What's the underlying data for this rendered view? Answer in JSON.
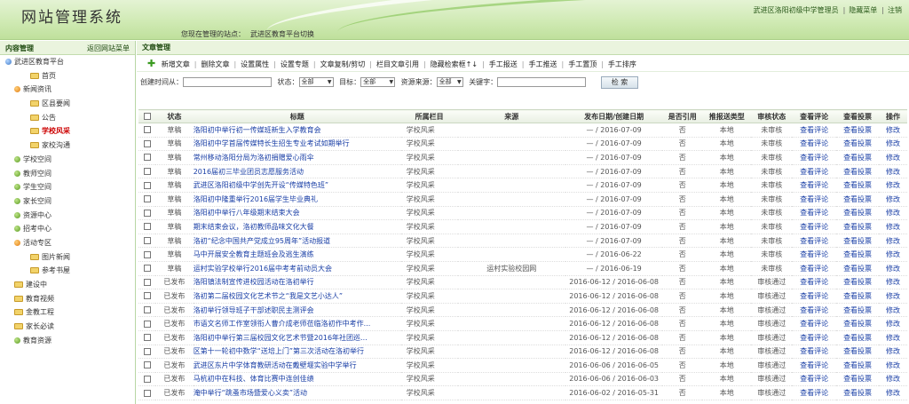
{
  "header": {
    "logo": "网站管理系统",
    "site_label": "您现在管理的站点：",
    "site_value": "武进区教育平台切换",
    "user": "武进区洛阳初级中学管理员",
    "hide_menu": "隐藏菜单",
    "logout": "注销"
  },
  "sidebar": {
    "title": "内容管理",
    "back": "返回网站菜单",
    "items": [
      {
        "label": "武进区教育平台",
        "level": 1,
        "icon": "globe-icon"
      },
      {
        "label": "首页",
        "level": 3,
        "icon": "folder-icon"
      },
      {
        "label": "新闻资讯",
        "level": 2,
        "icon": "orange-dot-icon"
      },
      {
        "label": "区县要闻",
        "level": 3,
        "icon": "folder-icon"
      },
      {
        "label": "公告",
        "level": 3,
        "icon": "folder-icon"
      },
      {
        "label": "学校风采",
        "level": 3,
        "icon": "folder-icon",
        "selected": true
      },
      {
        "label": "家校沟通",
        "level": 3,
        "icon": "folder-icon"
      },
      {
        "label": "学校空间",
        "level": 2,
        "icon": "green-dot-icon"
      },
      {
        "label": "教师空间",
        "level": 2,
        "icon": "green-dot-icon"
      },
      {
        "label": "学生空间",
        "level": 2,
        "icon": "green-dot-icon"
      },
      {
        "label": "家长空间",
        "level": 2,
        "icon": "green-dot-icon"
      },
      {
        "label": "资源中心",
        "level": 2,
        "icon": "green-dot-icon"
      },
      {
        "label": "招考中心",
        "level": 2,
        "icon": "green-dot-icon"
      },
      {
        "label": "活动专区",
        "level": 2,
        "icon": "orange-dot-icon"
      },
      {
        "label": "图片新闻",
        "level": 3,
        "icon": "folder-icon"
      },
      {
        "label": "参考书屋",
        "level": 3,
        "icon": "folder-icon"
      },
      {
        "label": "建设中",
        "level": 2,
        "icon": "folder-icon"
      },
      {
        "label": "教育视频",
        "level": 2,
        "icon": "folder-icon"
      },
      {
        "label": "金教工程",
        "level": 2,
        "icon": "folder-icon"
      },
      {
        "label": "家长必读",
        "level": 2,
        "icon": "folder-icon"
      },
      {
        "label": "教育资源",
        "level": 2,
        "icon": "green-dot-icon"
      }
    ]
  },
  "main": {
    "title": "文章管理",
    "toolbar": [
      "新增文章",
      "删除文章",
      "设置属性",
      "设置专题",
      "文章复制/剪切",
      "栏目文章引用",
      "隐藏检索框↑↓",
      "手工报送",
      "手工推送",
      "手工置顶",
      "手工排序"
    ],
    "filters": {
      "created_from": "创建时间从：",
      "status": "状态：",
      "status_value": "全部",
      "target": "目标：",
      "target_value": "全部",
      "source": "资源来源：",
      "source_value": "全部",
      "keyword": "关键字：",
      "search": "检 索"
    },
    "columns": [
      "状态",
      "标题",
      "所属栏目",
      "来源",
      "发布日期/创建日期",
      "是否引用",
      "推报送类型",
      "审核状态",
      "查看评论",
      "查看投票",
      "操作"
    ],
    "rows": [
      {
        "status": "草稿",
        "title": "洛阳初中举行初一传媒班新生入学教育会",
        "cat": "学校风采",
        "source": "",
        "date": "— / 2016-07-09",
        "ref": "否",
        "type": "本地",
        "audit": "未审核",
        "comment": "查看评论",
        "vote": "查看投票",
        "op": "修改"
      },
      {
        "status": "草稿",
        "title": "洛阳初中学首届传媒特长生招生专业考试如期举行",
        "cat": "学校风采",
        "source": "",
        "date": "— / 2016-07-09",
        "ref": "否",
        "type": "本地",
        "audit": "未审核",
        "comment": "查看评论",
        "vote": "查看投票",
        "op": "修改"
      },
      {
        "status": "草稿",
        "title": "常州移动洛阳分局为洛初捐赠爱心雨伞",
        "cat": "学校风采",
        "source": "",
        "date": "— / 2016-07-09",
        "ref": "否",
        "type": "本地",
        "audit": "未审核",
        "comment": "查看评论",
        "vote": "查看投票",
        "op": "修改"
      },
      {
        "status": "草稿",
        "title": "2016届初三毕业团员志愿服务活动",
        "cat": "学校风采",
        "source": "",
        "date": "— / 2016-07-09",
        "ref": "否",
        "type": "本地",
        "audit": "未审核",
        "comment": "查看评论",
        "vote": "查看投票",
        "op": "修改"
      },
      {
        "status": "草稿",
        "title": "武进区洛阳初级中学创先开设“传媒特色班”",
        "cat": "学校风采",
        "source": "",
        "date": "— / 2016-07-09",
        "ref": "否",
        "type": "本地",
        "audit": "未审核",
        "comment": "查看评论",
        "vote": "查看投票",
        "op": "修改"
      },
      {
        "status": "草稿",
        "title": "洛阳初中隆重举行2016届学生毕业典礼",
        "cat": "学校风采",
        "source": "",
        "date": "— / 2016-07-09",
        "ref": "否",
        "type": "本地",
        "audit": "未审核",
        "comment": "查看评论",
        "vote": "查看投票",
        "op": "修改"
      },
      {
        "status": "草稿",
        "title": "洛阳初中举行八年级期末结束大会",
        "cat": "学校风采",
        "source": "",
        "date": "— / 2016-07-09",
        "ref": "否",
        "type": "本地",
        "audit": "未审核",
        "comment": "查看评论",
        "vote": "查看投票",
        "op": "修改"
      },
      {
        "status": "草稿",
        "title": "期末结束会议，洛初教师品味文化大餐",
        "cat": "学校风采",
        "source": "",
        "date": "— / 2016-07-09",
        "ref": "否",
        "type": "本地",
        "audit": "未审核",
        "comment": "查看评论",
        "vote": "查看投票",
        "op": "修改"
      },
      {
        "status": "草稿",
        "title": "洛初“纪念中国共产党成立95周年”活动报道",
        "cat": "学校风采",
        "source": "",
        "date": "— / 2016-07-09",
        "ref": "否",
        "type": "本地",
        "audit": "未审核",
        "comment": "查看评论",
        "vote": "查看投票",
        "op": "修改"
      },
      {
        "status": "草稿",
        "title": "马中开展安全教育主题班会及逃生演练",
        "cat": "学校风采",
        "source": "",
        "date": "— / 2016-06-22",
        "ref": "否",
        "type": "本地",
        "audit": "未审核",
        "comment": "查看评论",
        "vote": "查看投票",
        "op": "修改"
      },
      {
        "status": "草稿",
        "title": "运村实验学校举行2016届中考考前动员大会",
        "cat": "学校风采",
        "source": "运村实验校园网",
        "date": "— / 2016-06-19",
        "ref": "否",
        "type": "本地",
        "audit": "未审核",
        "comment": "查看评论",
        "vote": "查看投票",
        "op": "修改"
      },
      {
        "status": "已发布",
        "title": "洛阳镇法制宣传进校园活动在洛初举行",
        "cat": "学校风采",
        "source": "",
        "date": "2016-06-12 / 2016-06-08",
        "ref": "否",
        "type": "本地",
        "audit": "审核通过",
        "comment": "查看评论",
        "vote": "查看投票",
        "op": "修改"
      },
      {
        "status": "已发布",
        "title": "洛初第二届校园文化艺术节之“我是文艺小达人”",
        "cat": "学校风采",
        "source": "",
        "date": "2016-06-12 / 2016-06-08",
        "ref": "否",
        "type": "本地",
        "audit": "审核通过",
        "comment": "查看评论",
        "vote": "查看投票",
        "op": "修改"
      },
      {
        "status": "已发布",
        "title": "洛初举行领导班子干部述职民主测评会",
        "cat": "学校风采",
        "source": "",
        "date": "2016-06-12 / 2016-06-08",
        "ref": "否",
        "type": "本地",
        "audit": "审核通过",
        "comment": "查看评论",
        "vote": "查看投票",
        "op": "修改"
      },
      {
        "status": "已发布",
        "title": "市语文名师工作室领衔人曹介成老师莅临洛初作中考作...",
        "cat": "学校风采",
        "source": "",
        "date": "2016-06-12 / 2016-06-08",
        "ref": "否",
        "type": "本地",
        "audit": "审核通过",
        "comment": "查看评论",
        "vote": "查看投票",
        "op": "修改"
      },
      {
        "status": "已发布",
        "title": "洛阳初中举行第三届校园文化艺术节暨2016年社团巡...",
        "cat": "学校风采",
        "source": "",
        "date": "2016-06-12 / 2016-06-08",
        "ref": "否",
        "type": "本地",
        "audit": "审核通过",
        "comment": "查看评论",
        "vote": "查看投票",
        "op": "修改"
      },
      {
        "status": "已发布",
        "title": "区第十一轮初中数学“送培上门”第三次活动在洛初举行",
        "cat": "学校风采",
        "source": "",
        "date": "2016-06-12 / 2016-06-08",
        "ref": "否",
        "type": "本地",
        "audit": "审核通过",
        "comment": "查看评论",
        "vote": "查看投票",
        "op": "修改"
      },
      {
        "status": "已发布",
        "title": "武进区东片中学体育教研活动在戴壁堰实验中学举行",
        "cat": "学校风采",
        "source": "",
        "date": "2016-06-06 / 2016-06-05",
        "ref": "否",
        "type": "本地",
        "audit": "审核通过",
        "comment": "查看评论",
        "vote": "查看投票",
        "op": "修改"
      },
      {
        "status": "已发布",
        "title": "马杭初中在科技、体育比赛中连创佳绩",
        "cat": "学校风采",
        "source": "",
        "date": "2016-06-06 / 2016-06-03",
        "ref": "否",
        "type": "本地",
        "audit": "审核通过",
        "comment": "查看评论",
        "vote": "查看投票",
        "op": "修改"
      },
      {
        "status": "已发布",
        "title": "淹中举行“跳蚤市场暨爱心义卖”活动",
        "cat": "学校风采",
        "source": "",
        "date": "2016-06-02 / 2016-05-31",
        "ref": "否",
        "type": "本地",
        "audit": "审核通过",
        "comment": "查看评论",
        "vote": "查看投票",
        "op": "修改"
      }
    ]
  }
}
